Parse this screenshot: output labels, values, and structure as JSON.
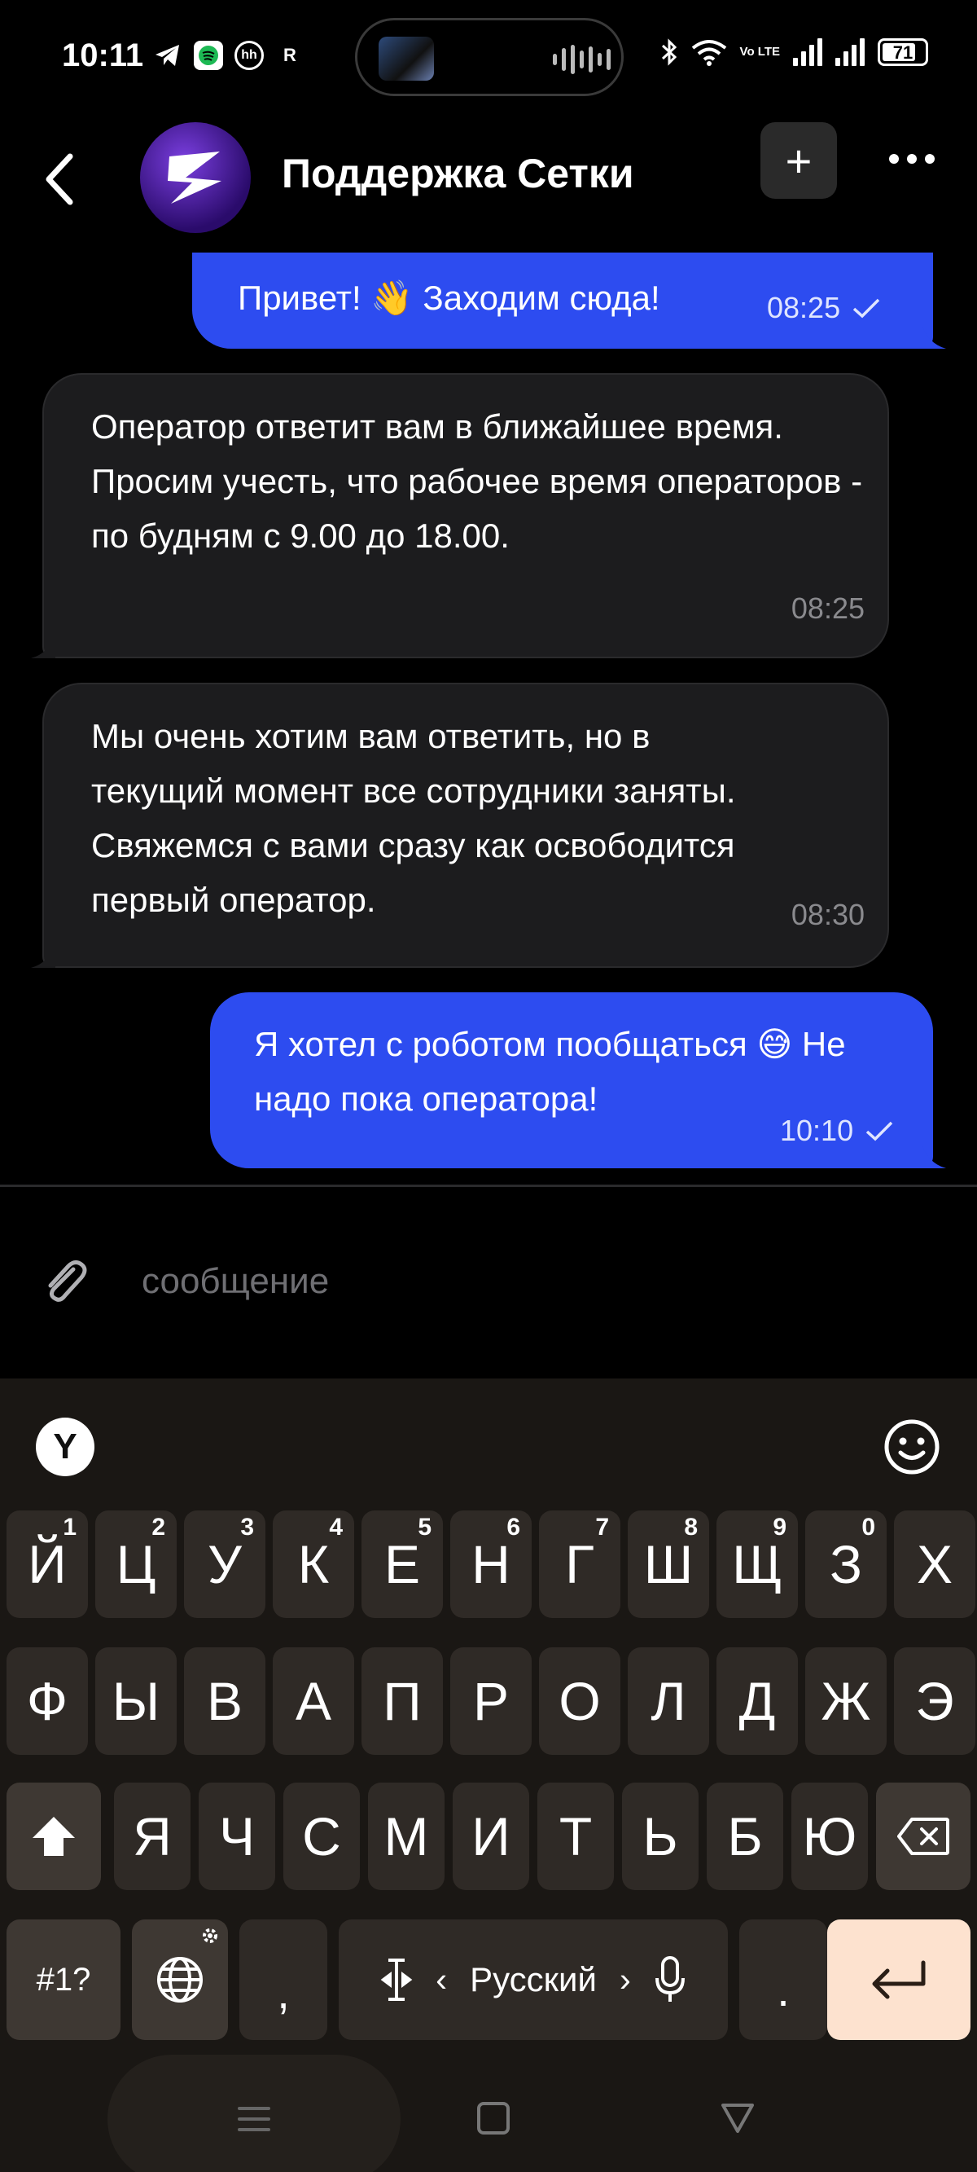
{
  "status_bar": {
    "time": "10:11",
    "left_icons": [
      "telegram-icon",
      "spotify-icon",
      "hh-icon",
      "r-icon"
    ],
    "right_icons": [
      "audio-wave-icon",
      "bluetooth-icon",
      "wifi-icon",
      "volte-icon",
      "signal-icon",
      "signal-icon"
    ],
    "volte_label": "Vo LTE",
    "battery": "71"
  },
  "header": {
    "title": "Поддержка Сетки",
    "back_icon": "chevron-left-icon",
    "plus_label": "+",
    "more_icon": "more-horizontal-icon"
  },
  "messages": [
    {
      "direction": "out",
      "text": "Привет! 👋 Заходим сюда!",
      "time": "08:25",
      "status": "read"
    },
    {
      "direction": "in",
      "text": "Оператор ответит вам в ближайшее время. Просим учесть, что рабочее время операторов - по будням с 9.00 до 18.00.",
      "time": "08:25"
    },
    {
      "direction": "in",
      "text": "Мы очень хотим вам ответить, но в текущий момент все сотрудники заняты. Свяжемся с вами сразу как освободится первый оператор.",
      "time": "08:30"
    },
    {
      "direction": "out",
      "text": "Я хотел с роботом пообщаться 😅 Не надо пока оператора!",
      "time": "10:10",
      "status": "read"
    }
  ],
  "composer": {
    "placeholder": "сообщение",
    "attach_icon": "paperclip-icon"
  },
  "keyboard": {
    "yandex_label": "Y",
    "row1": [
      {
        "k": "Й",
        "s": "1"
      },
      {
        "k": "Ц",
        "s": "2"
      },
      {
        "k": "У",
        "s": "3"
      },
      {
        "k": "К",
        "s": "4"
      },
      {
        "k": "Е",
        "s": "5"
      },
      {
        "k": "Н",
        "s": "6"
      },
      {
        "k": "Г",
        "s": "7"
      },
      {
        "k": "Ш",
        "s": "8"
      },
      {
        "k": "Щ",
        "s": "9"
      },
      {
        "k": "З",
        "s": "0"
      },
      {
        "k": "Х",
        "s": ""
      }
    ],
    "row2": [
      "Ф",
      "Ы",
      "В",
      "А",
      "П",
      "Р",
      "О",
      "Л",
      "Д",
      "Ж",
      "Э"
    ],
    "row3": [
      "Я",
      "Ч",
      "С",
      "М",
      "И",
      "Т",
      "Ь",
      "Б",
      "Ю"
    ],
    "symbols_label": "#1?",
    "comma_label": ",",
    "space_label": "Русский",
    "period_label": ".",
    "lang_prev": "‹",
    "lang_next": "›"
  },
  "colors": {
    "outgoing_bubble": "#2d4cf0",
    "incoming_bubble": "#1c1c1e",
    "enter_key": "#fde2cf"
  }
}
